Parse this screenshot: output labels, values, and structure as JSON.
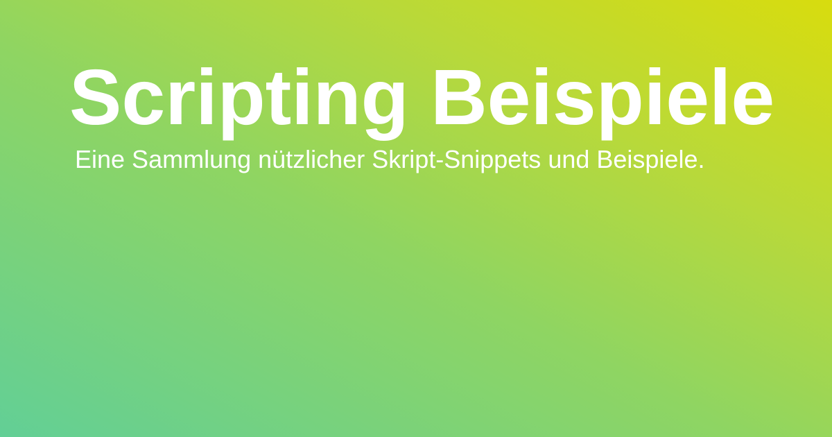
{
  "title": "Scripting Beispiele",
  "subtitle": "Eine Sammlung nützlicher Skript-Snippets und Beispiele.",
  "colors": {
    "gradient_start": "#62cf96",
    "gradient_end": "#d8dc0e",
    "text": "#ffffff"
  }
}
